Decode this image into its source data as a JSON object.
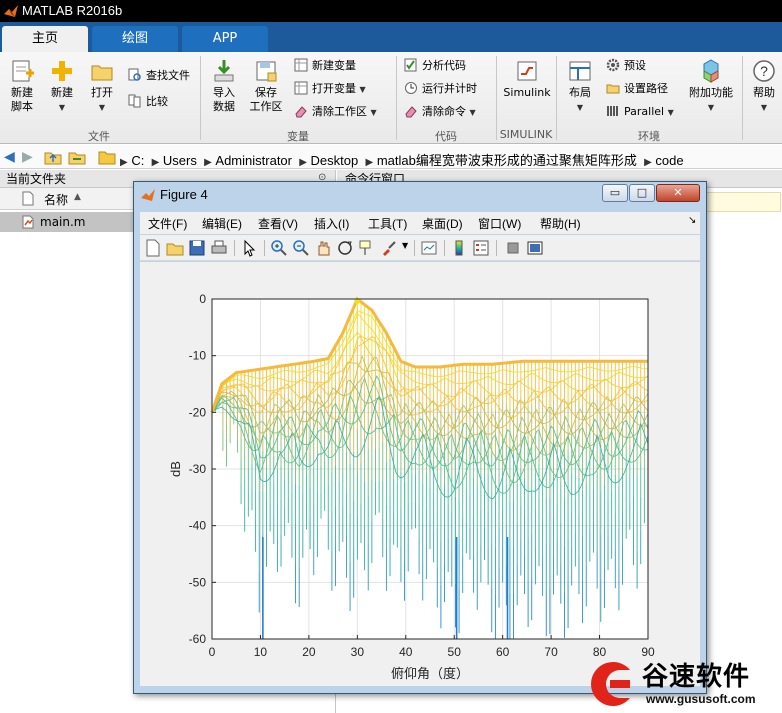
{
  "app": {
    "title": "MATLAB R2016b"
  },
  "tabs": [
    "主页",
    "绘图",
    "APP"
  ],
  "ribbon": {
    "new_script": [
      "新建",
      "脚本"
    ],
    "new": "新建",
    "open": "打开",
    "find_files": "查找文件",
    "compare": "比较",
    "import_data": [
      "导入",
      "数据"
    ],
    "save_workspace": [
      "保存",
      "工作区"
    ],
    "new_variable": "新建变量",
    "open_variable": "打开变量",
    "clear_workspace": "清除工作区",
    "analyze_code": "分析代码",
    "run_and_time": "运行并计时",
    "clear_commands": "清除命令",
    "simulink": "Simulink",
    "layout": "布局",
    "preferences": "预设",
    "set_path": "设置路径",
    "parallel": "Parallel",
    "addons": "附加功能",
    "help": "帮助",
    "groups": {
      "file": "文件",
      "variable": "变量",
      "code": "代码",
      "simulink": "SIMULINK",
      "environment": "环境"
    }
  },
  "address": {
    "crumbs": [
      "C:",
      "Users",
      "Administrator",
      "Desktop",
      "matlab编程宽带波束形成的通过聚焦矩阵形成",
      "code"
    ]
  },
  "left_panel": {
    "title": "当前文件夹",
    "column_name": "名称",
    "files": [
      "main.m"
    ]
  },
  "right_panel": {
    "title": "命令行窗口"
  },
  "figure": {
    "title": "Figure 4",
    "menu": [
      "文件(F)",
      "编辑(E)",
      "查看(V)",
      "插入(I)",
      "工具(T)",
      "桌面(D)",
      "窗口(W)",
      "帮助(H)"
    ],
    "window_buttons": {
      "min": "▭",
      "max": "□",
      "close": "✕"
    }
  },
  "chart_data": {
    "type": "surface-mesh",
    "view": "side (elevation 0)",
    "xlabel": "俯仰角（度）",
    "ylabel": "dB",
    "xlim": [
      0,
      90
    ],
    "ylim": [
      -60,
      0
    ],
    "xticks": [
      0,
      10,
      20,
      30,
      40,
      50,
      60,
      70,
      80,
      90
    ],
    "yticks": [
      0,
      -10,
      -20,
      -30,
      -40,
      -50,
      -60
    ],
    "grid": true,
    "colormap": "parula",
    "colors": {
      "low": "#1f7fd0",
      "mid": "#3cbf94",
      "high": "#f2e21d",
      "top": "#f6b93b"
    },
    "mainlobe": {
      "x": 30,
      "y": 0
    },
    "upper_envelope": {
      "x": [
        0,
        2,
        5,
        9,
        13,
        17,
        21,
        24,
        27,
        30,
        33,
        36,
        39,
        42,
        47,
        52,
        58,
        64,
        70,
        76,
        82,
        90
      ],
      "y": [
        -20,
        -15,
        -13,
        -12.5,
        -12,
        -11.5,
        -11,
        -10.5,
        -6,
        0,
        -2,
        -6,
        -11,
        -12,
        -12,
        -11.5,
        -11.5,
        -11,
        -11,
        -11,
        -11,
        -11
      ]
    },
    "lower_envelope": {
      "x": [
        0,
        3,
        6,
        10,
        14,
        18,
        22,
        26,
        30,
        34,
        38,
        42,
        46,
        50,
        54,
        58,
        62,
        66,
        70,
        74,
        78,
        82,
        86,
        90
      ],
      "y": [
        -20,
        -24,
        -32,
        -52,
        -42,
        -50,
        -41,
        -48,
        -50,
        -42,
        -49,
        -45,
        -51,
        -55,
        -48,
        -55,
        -57,
        -52,
        -55,
        -54,
        -50,
        -52,
        -46,
        -44
      ]
    },
    "nulls": [
      {
        "x": 10.5,
        "y": -60
      },
      {
        "x": 50.5,
        "y": -60
      },
      {
        "x": 61,
        "y": -60
      }
    ]
  },
  "watermark": {
    "brand": "谷速软件",
    "url": "www.gususoft.com"
  }
}
